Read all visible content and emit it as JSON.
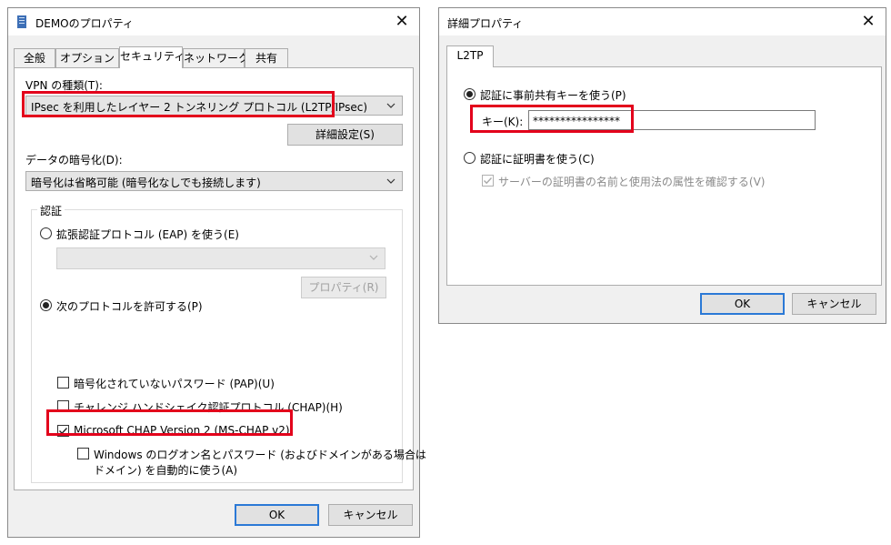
{
  "left_dialog": {
    "title": "DEMOのプロパティ",
    "tabs": [
      {
        "label": "全般"
      },
      {
        "label": "オプション"
      },
      {
        "label": "セキュリティ"
      },
      {
        "label": "ネットワーク"
      },
      {
        "label": "共有"
      }
    ],
    "active_tab": "セキュリティ",
    "vpn_type_label": "VPN の種類(T):",
    "vpn_type_value": "IPsec を利用したレイヤー 2 トンネリング プロトコル (L2TP/IPsec)",
    "advanced_button": "詳細設定(S)",
    "encryption_label": "データの暗号化(D):",
    "encryption_value": "暗号化は省略可能 (暗号化なしでも接続します)",
    "auth_group_title": "認証",
    "eap_radio_label": "拡張認証プロトコル (EAP) を使う(E)",
    "eap_properties_button": "プロパティ(R)",
    "allow_protocols_radio_label": "次のプロトコルを許可する(P)",
    "pap_label": "暗号化されていないパスワード (PAP)(U)",
    "chap_label": "チャレンジ ハンドシェイク認証プロトコル (CHAP)(H)",
    "mschap_label": "Microsoft CHAP Version 2 (MS-CHAP v2)",
    "windows_logon_label_line1": "Windows のログオン名とパスワード (およびドメインがある場合は",
    "windows_logon_label_line2": "ドメイン) を自動的に使う(A)",
    "ok_button": "OK",
    "cancel_button": "キャンセル"
  },
  "right_dialog": {
    "title": "詳細プロパティ",
    "tab": "L2TP",
    "psk_radio_label": "認証に事前共有キーを使う(P)",
    "key_label": "キー(K):",
    "key_value": "****************",
    "cert_radio_label": "認証に証明書を使う(C)",
    "verify_server_label": "サーバーの証明書の名前と使用法の属性を確認する(V)",
    "ok_button": "OK",
    "cancel_button": "キャンセル"
  },
  "colors": {
    "highlight": "#e3001b",
    "default_button_border": "#2b79d6"
  }
}
